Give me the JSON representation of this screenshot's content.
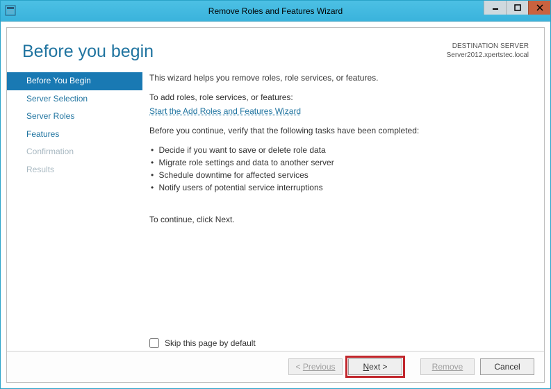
{
  "window": {
    "title": "Remove Roles and Features Wizard"
  },
  "header": {
    "page_title": "Before you begin",
    "destination_label": "DESTINATION SERVER",
    "destination_server": "Server2012.xpertstec.local"
  },
  "nav": {
    "items": [
      {
        "label": "Before You Begin",
        "state": "selected"
      },
      {
        "label": "Server Selection",
        "state": "enabled"
      },
      {
        "label": "Server Roles",
        "state": "enabled"
      },
      {
        "label": "Features",
        "state": "enabled"
      },
      {
        "label": "Confirmation",
        "state": "disabled"
      },
      {
        "label": "Results",
        "state": "disabled"
      }
    ]
  },
  "main": {
    "intro": "This wizard helps you remove roles, role services, or features.",
    "add_label": "To add roles, role services, or features:",
    "add_link": "Start the Add Roles and Features Wizard",
    "verify": "Before you continue, verify that the following tasks have been completed:",
    "bullets": [
      "Decide if you want to save or delete role data",
      "Migrate role settings and data to another server",
      "Schedule downtime for affected services",
      "Notify users of potential service interruptions"
    ],
    "continue": "To continue, click Next.",
    "skip_label": "Skip this page by default"
  },
  "footer": {
    "previous": "Previous",
    "next": "Next >",
    "remove": "Remove",
    "cancel": "Cancel"
  }
}
